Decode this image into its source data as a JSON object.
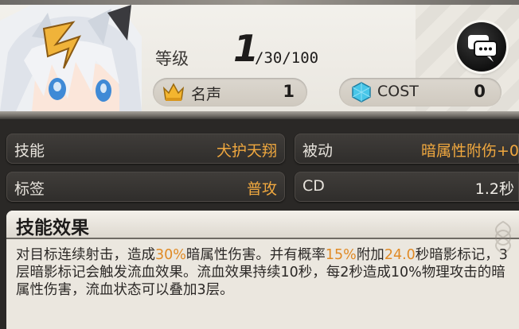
{
  "header": {
    "level_label": "等级",
    "level_current": "1",
    "level_max": "/30/100",
    "fame_label": "名声",
    "fame_value": "1",
    "cost_label": "COST",
    "cost_value": "0"
  },
  "skill": {
    "skill_label": "技能",
    "skill_value": "犬护天翔",
    "passive_label": "被动",
    "passive_value": "暗属性附伤+0",
    "tag_label": "标签",
    "tag_value": "普攻",
    "cd_label": "CD",
    "cd_value": "1.2秒"
  },
  "effect": {
    "title": "技能效果",
    "p1": "对目标连续射击，造成",
    "p1_hl": "30%",
    "p2": "暗属性伤害。并有概率",
    "p2_hl": "15%",
    "p3": "附加",
    "p3_hl": "24.0",
    "p4": "秒暗影标记，3层暗影标记会触发流血效果。流血效果持续10秒，每2秒造成10%物理攻击的暗属性伤害，流血状态可以叠加3层。"
  },
  "icons": {
    "fame": "crown-icon",
    "cost": "crystal-icon",
    "chat": "chat-bubble-icon"
  },
  "colors": {
    "highlight": "#e08a25",
    "panel_dark": "#2f2d2b",
    "value_orange": "#f0a83f"
  }
}
